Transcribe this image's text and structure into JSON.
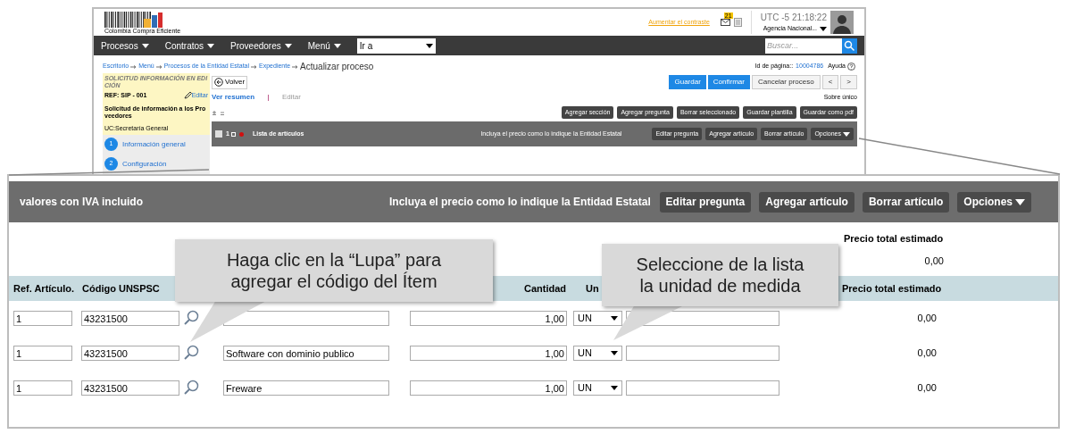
{
  "screen": {
    "logo": "Colombia Compra Eficiente",
    "contrast_link": "Aumentar el contraste",
    "notification_count": "21",
    "timezone": "UTC -5",
    "time": "21:18:22",
    "agency": "Agencia Nacional...",
    "nav": [
      "Procesos",
      "Contratos",
      "Proveedores",
      "Menú"
    ],
    "goto": "Ir a",
    "search_placeholder": "Buscar...",
    "breadcrumb": [
      "Escritorio",
      "Menú",
      "Procesos de la Entidad Estatal",
      "Expediente"
    ],
    "page_title": "Actualizar proceso",
    "page_id_label": "Id de página::",
    "page_id": "10004786",
    "help": "Ayuda",
    "sidebar": {
      "status": "SOLICITUD INFORMACIÓN EN EDICIÓN",
      "ref": "REF: SIP - 001",
      "edit": "Editar",
      "name": "Solicitud de información a los Proveedores",
      "unit": "UC:Secretaría General",
      "steps": [
        {
          "number": "1",
          "label": "Información general"
        },
        {
          "number": "2",
          "label": "Configuración"
        }
      ]
    },
    "back": "Volver",
    "view_tabs": [
      {
        "label": "Ver resumen",
        "selected": true
      },
      {
        "label": "Editar",
        "selected": false
      }
    ],
    "actions": [
      {
        "label": "Guardar",
        "kind": "primary"
      },
      {
        "label": "Confirmar",
        "kind": "primary"
      },
      {
        "label": "Cancelar proceso",
        "kind": "secondary"
      },
      {
        "label": "<",
        "kind": "secondary"
      },
      {
        "label": ">",
        "kind": "secondary"
      }
    ],
    "envelope": "Sobre único",
    "toolbar": [
      "Agregar sección",
      "Agregar pregunta",
      "Borrar seleccionado",
      "Guardar plantilla",
      "Guardar como pdf"
    ],
    "section": {
      "checked": false,
      "number": "1",
      "title": "Lista de artículos",
      "note": "Incluya el precio como lo indique la Entidad Estatal",
      "buttons": [
        "Editar pregunta",
        "Agregar artículo",
        "Borrar artículo",
        "Opciones"
      ]
    }
  },
  "zoomed": {
    "label": "valores con IVA incluido",
    "note": "Incluya el precio como lo indique la Entidad Estatal",
    "buttons": [
      "Editar pregunta",
      "Agregar artículo",
      "Borrar artículo",
      "Opciones"
    ],
    "total_label": "Precio total estimado",
    "total_value": "0,00",
    "headers": {
      "ref": "Ref. Artículo.",
      "code": "Código UNSPSC",
      "quantity": "Cantidad",
      "unit": "Un",
      "price": "Precio total estimado"
    },
    "rows": [
      {
        "ref": "1",
        "code": "43231500",
        "quantity": "1,00",
        "unit": "UN",
        "price": "0,00"
      },
      {
        "ref": "1",
        "code": "43231500",
        "description": "Software con dominio publico",
        "quantity": "1,00",
        "unit": "UN",
        "price": "0,00"
      },
      {
        "ref": "1",
        "code": "43231500",
        "description": "Freware",
        "quantity": "1,00",
        "unit": "UN",
        "price": "0,00"
      }
    ]
  },
  "callouts": [
    {
      "text": "Haga clic en la “Lupa” para agregar el código del Ítem"
    },
    {
      "text": "Seleccione de la lista la unidad de medida"
    }
  ]
}
